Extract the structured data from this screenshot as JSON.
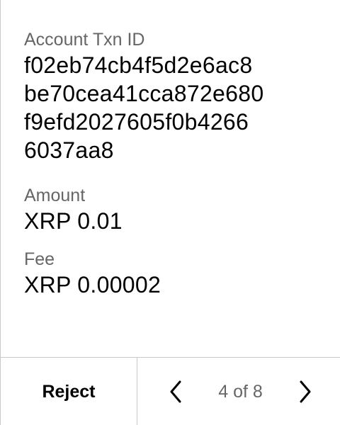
{
  "fields": {
    "txn_id": {
      "label": "Account Txn ID",
      "lines": [
        "f02eb74cb4f5d2e6ac8",
        "be70cea41cca872e680",
        "f9efd2027605f0b4266",
        "6037aa8"
      ]
    },
    "amount": {
      "label": "Amount",
      "value": "XRP 0.01"
    },
    "fee": {
      "label": "Fee",
      "value": "XRP 0.00002"
    }
  },
  "footer": {
    "reject_label": "Reject",
    "page_indicator": "4 of 8",
    "icons": {
      "prev": "chevron-left-icon",
      "next": "chevron-right-icon"
    }
  },
  "colors": {
    "label": "#666666",
    "value": "#000000",
    "divider": "#c8c8c8"
  }
}
